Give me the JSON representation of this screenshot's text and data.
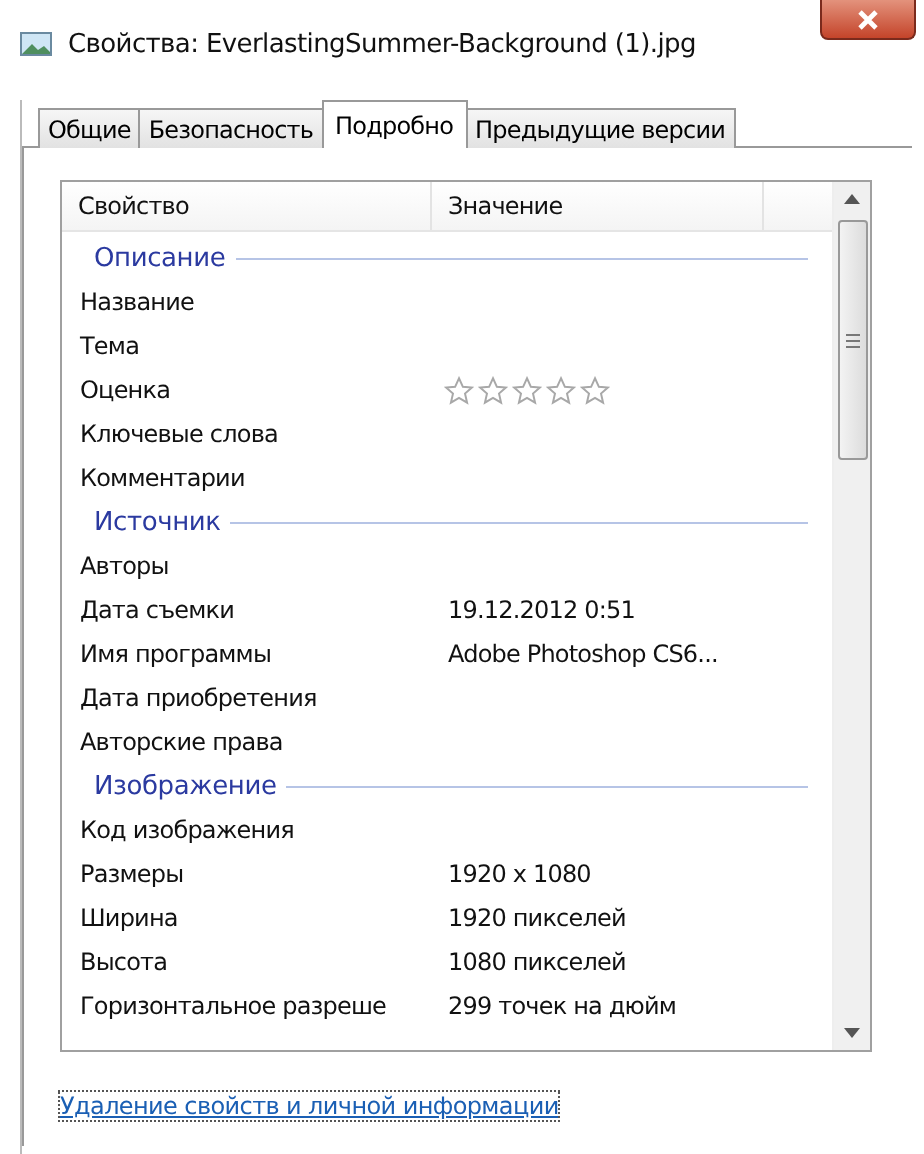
{
  "window": {
    "title": "Свойства: EverlastingSummer-Background (1).jpg"
  },
  "tabs": [
    {
      "label": "Общие",
      "selected": false
    },
    {
      "label": "Безопасность",
      "selected": false
    },
    {
      "label": "Подробно",
      "selected": true
    },
    {
      "label": "Предыдущие версии",
      "selected": false
    }
  ],
  "table": {
    "columns": [
      "Свойство",
      "Значение"
    ],
    "rows": [
      {
        "kind": "group",
        "label": "Описание"
      },
      {
        "kind": "text",
        "property": "Название"
      },
      {
        "kind": "text",
        "property": "Тема"
      },
      {
        "kind": "rating",
        "property": "Оценка",
        "stars": 0
      },
      {
        "kind": "text",
        "property": "Ключевые слова"
      },
      {
        "kind": "text",
        "property": "Комментарии"
      },
      {
        "kind": "group",
        "label": "Источник"
      },
      {
        "kind": "text",
        "property": "Авторы"
      },
      {
        "kind": "text",
        "property": "Дата съемки",
        "value": "19.12.2012 0:51"
      },
      {
        "kind": "text",
        "property": "Имя программы",
        "value": "Adobe Photoshop CS6..."
      },
      {
        "kind": "text",
        "property": "Дата приобретения"
      },
      {
        "kind": "text",
        "property": "Авторские права"
      },
      {
        "kind": "group",
        "label": "Изображение"
      },
      {
        "kind": "text",
        "property": "Код изображения"
      },
      {
        "kind": "text",
        "property": "Размеры",
        "value": "1920 x 1080"
      },
      {
        "kind": "text",
        "property": "Ширина",
        "value": "1920 пикселей"
      },
      {
        "kind": "text",
        "property": "Высота",
        "value": "1080 пикселей"
      },
      {
        "kind": "text",
        "property": "Горизонтальное разреше",
        "value": "299 точек на дюйм"
      }
    ]
  },
  "link": "Удаление свойств и личной информации"
}
